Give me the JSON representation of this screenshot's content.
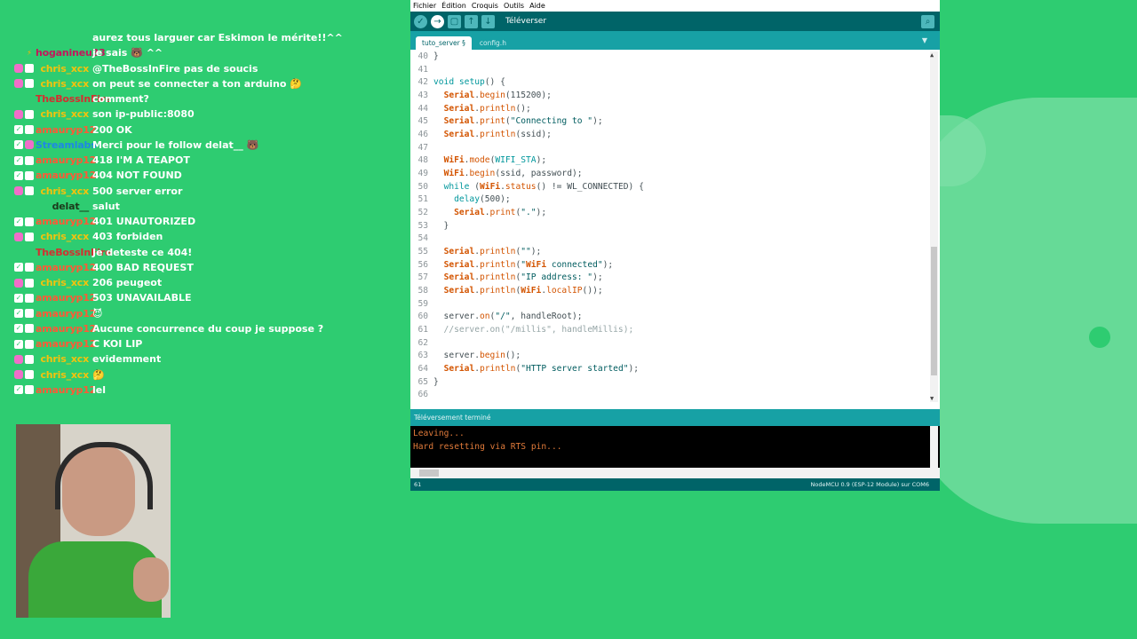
{
  "chat": {
    "rows": [
      {
        "user": "",
        "msg": "aurez tous larguer car Eskimon le mérite!!^^",
        "color": "#ffffff",
        "badges": []
      },
      {
        "user": "hoganineu33",
        "msg": "je sais 🐻 ^^",
        "color": "#c2185b",
        "badges": [
          "bolt"
        ]
      },
      {
        "user": "chris_xcx",
        "msg": "@TheBossInFire pas de soucis",
        "color": "#f4c20d",
        "badges": [
          "sub",
          "cam"
        ]
      },
      {
        "user": "chris_xcx",
        "msg": "on peut se connecter a ton arduino 🤔",
        "color": "#f4c20d",
        "badges": [
          "sub",
          "cam"
        ]
      },
      {
        "user": "TheBossInFire",
        "msg": "comment?",
        "color": "#d32f2f",
        "badges": []
      },
      {
        "user": "chris_xcx",
        "msg": "son ip-public:8080",
        "color": "#f4c20d",
        "badges": [
          "sub",
          "cam"
        ]
      },
      {
        "user": "amauryp12",
        "msg": "200 OK",
        "color": "#ff5a36",
        "badges": [
          "mod",
          "cam"
        ]
      },
      {
        "user": "Streamlabs",
        "msg": "Merci pour le follow delat__ 🐻",
        "color": "#1e88e5",
        "badges": [
          "mod",
          "sub"
        ]
      },
      {
        "user": "amauryp12",
        "msg": "418 I'M A TEAPOT",
        "color": "#ff5a36",
        "badges": [
          "mod",
          "cam"
        ]
      },
      {
        "user": "amauryp12",
        "msg": "404 NOT FOUND",
        "color": "#ff5a36",
        "badges": [
          "mod",
          "cam"
        ]
      },
      {
        "user": "chris_xcx",
        "msg": "500 server error",
        "color": "#f4c20d",
        "badges": [
          "sub",
          "cam"
        ]
      },
      {
        "user": "delat__",
        "msg": "salut",
        "color": "#1b3a1b",
        "badges": []
      },
      {
        "user": "amauryp12",
        "msg": "401 UNAUTORIZED",
        "color": "#ff5a36",
        "badges": [
          "mod",
          "cam"
        ]
      },
      {
        "user": "chris_xcx",
        "msg": "403 forbiden",
        "color": "#f4c20d",
        "badges": [
          "sub",
          "cam"
        ]
      },
      {
        "user": "TheBossInFire",
        "msg": "Je deteste ce 404!",
        "color": "#d32f2f",
        "badges": []
      },
      {
        "user": "amauryp12",
        "msg": "400 BAD REQUEST",
        "color": "#ff5a36",
        "badges": [
          "mod",
          "cam"
        ]
      },
      {
        "user": "chris_xcx",
        "msg": "206 peugeot",
        "color": "#f4c20d",
        "badges": [
          "sub",
          "cam"
        ]
      },
      {
        "user": "amauryp12",
        "msg": "503 UNAVAILABLE",
        "color": "#ff5a36",
        "badges": [
          "mod",
          "cam"
        ]
      },
      {
        "user": "amauryp12",
        "msg": "😈",
        "color": "#ff5a36",
        "badges": [
          "mod",
          "cam"
        ]
      },
      {
        "user": "amauryp12",
        "msg": "Aucune concurrence du coup je suppose ?",
        "color": "#ff5a36",
        "badges": [
          "mod",
          "cam"
        ]
      },
      {
        "user": "amauryp12",
        "msg": "C KOI LIP",
        "color": "#ff5a36",
        "badges": [
          "mod",
          "cam"
        ]
      },
      {
        "user": "chris_xcx",
        "msg": "evidemment",
        "color": "#f4c20d",
        "badges": [
          "sub",
          "cam"
        ]
      },
      {
        "user": "chris_xcx",
        "msg": "🤔",
        "color": "#f4c20d",
        "badges": [
          "sub",
          "cam"
        ]
      },
      {
        "user": "amauryp12",
        "msg": "lel",
        "color": "#ff5a36",
        "badges": [
          "mod",
          "cam"
        ]
      }
    ]
  },
  "ide": {
    "menu": [
      "Fichier",
      "Édition",
      "Croquis",
      "Outils",
      "Aide"
    ],
    "toolbar": {
      "label": "Téléverser"
    },
    "tabs": [
      "tuto_server §",
      "config.h"
    ],
    "code": [
      {
        "n": "40",
        "t": "}"
      },
      {
        "n": "41",
        "t": ""
      },
      {
        "n": "42",
        "t": "void setup() {"
      },
      {
        "n": "43",
        "t": "  Serial.begin(115200);"
      },
      {
        "n": "44",
        "t": "  Serial.println();"
      },
      {
        "n": "45",
        "t": "  Serial.print(\"Connecting to \");"
      },
      {
        "n": "46",
        "t": "  Serial.println(ssid);"
      },
      {
        "n": "47",
        "t": ""
      },
      {
        "n": "48",
        "t": "  WiFi.mode(WIFI_STA);"
      },
      {
        "n": "49",
        "t": "  WiFi.begin(ssid, password);"
      },
      {
        "n": "50",
        "t": "  while (WiFi.status() != WL_CONNECTED) {"
      },
      {
        "n": "51",
        "t": "    delay(500);"
      },
      {
        "n": "52",
        "t": "    Serial.print(\".\");"
      },
      {
        "n": "53",
        "t": "  }"
      },
      {
        "n": "54",
        "t": ""
      },
      {
        "n": "55",
        "t": "  Serial.println(\"\");"
      },
      {
        "n": "56",
        "t": "  Serial.println(\"WiFi connected\");"
      },
      {
        "n": "57",
        "t": "  Serial.println(\"IP address: \");"
      },
      {
        "n": "58",
        "t": "  Serial.println(WiFi.localIP());"
      },
      {
        "n": "59",
        "t": ""
      },
      {
        "n": "60",
        "t": "  server.on(\"/\", handleRoot);"
      },
      {
        "n": "61",
        "t": "  //server.on(\"/millis\", handleMillis);"
      },
      {
        "n": "62",
        "t": ""
      },
      {
        "n": "63",
        "t": "  server.begin();"
      },
      {
        "n": "64",
        "t": "  Serial.println(\"HTTP server started\");"
      },
      {
        "n": "65",
        "t": "}"
      },
      {
        "n": "66",
        "t": ""
      }
    ],
    "status": "Téléversement terminé",
    "console": [
      "Leaving...",
      "Hard resetting via RTS pin..."
    ],
    "footer": {
      "line": "61",
      "board": "NodeMCU 0.9 (ESP-12 Module) sur COM6"
    },
    "colors": {
      "toolbar": "#006468",
      "tabbar": "#17a1a5",
      "keyword": "#d35400",
      "type": "#00979c",
      "string": "#005c5f"
    }
  }
}
